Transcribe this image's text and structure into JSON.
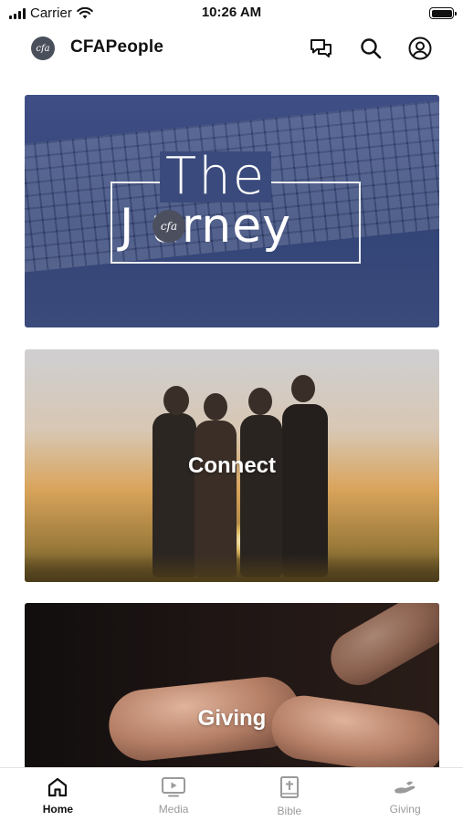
{
  "status_bar": {
    "carrier": "Carrier",
    "time": "10:26 AM"
  },
  "header": {
    "logo_text": "cfa",
    "title": "CFAPeople",
    "icons": [
      "chat-icon",
      "search-icon",
      "profile-icon"
    ]
  },
  "cards": [
    {
      "label": "",
      "logo_the": "The",
      "logo_word": "J  urney",
      "badge": "cfa"
    },
    {
      "label": "Connect"
    },
    {
      "label": "Giving"
    }
  ],
  "tabs": [
    {
      "label": "Home",
      "icon": "home-icon",
      "active": true
    },
    {
      "label": "Media",
      "icon": "media-icon",
      "active": false
    },
    {
      "label": "Bible",
      "icon": "bible-icon",
      "active": false
    },
    {
      "label": "Giving",
      "icon": "giving-icon",
      "active": false
    }
  ],
  "colors": {
    "accent": "#111111",
    "inactive_tab": "#9a9a9a",
    "journey_blue": "#3a4a7c"
  }
}
